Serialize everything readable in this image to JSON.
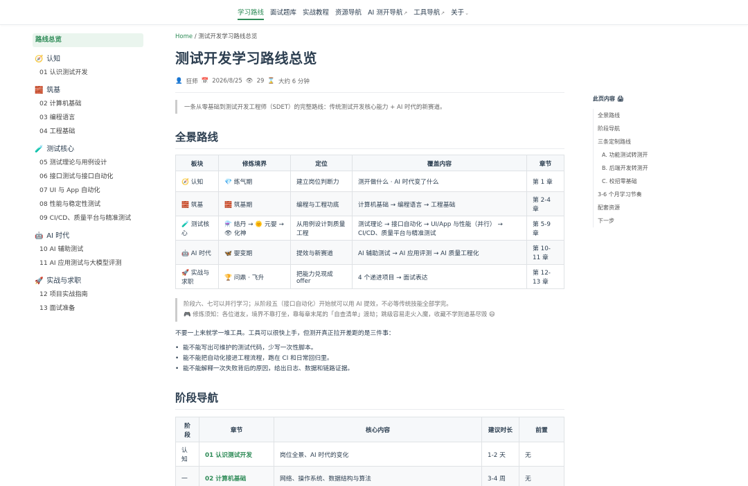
{
  "nav": {
    "items": [
      "学习路线",
      "面试题库",
      "实战教程",
      "资源导航",
      "AI 测开导航",
      "工具导航",
      "关于"
    ],
    "ext_mark": "↗",
    "dropdown_mark": "⌄"
  },
  "sidebar": {
    "overview": "路线总览",
    "groups": [
      {
        "icon": "🧭",
        "title": "认知",
        "items": [
          "01 认识测试开发"
        ]
      },
      {
        "icon": "🧱",
        "title": "筑基",
        "items": [
          "02 计算机基础",
          "03 编程语言",
          "04 工程基础"
        ]
      },
      {
        "icon": "🧪",
        "title": "测试核心",
        "items": [
          "05 测试理论与用例设计",
          "06 接口测试与接口自动化",
          "07 UI 与 App 自动化",
          "08 性能与稳定性测试",
          "09 CI/CD、质量平台与精准测试"
        ]
      },
      {
        "icon": "🤖",
        "title": "AI 时代",
        "items": [
          "10 AI 辅助测试",
          "11 AI 应用测试与大模型评测"
        ]
      },
      {
        "icon": "🚀",
        "title": "实战与求职",
        "items": [
          "12 项目实战指南",
          "13 面试准备"
        ]
      }
    ]
  },
  "main": {
    "breadcrumb": {
      "home": "Home",
      "sep": "/",
      "current": "测试开发学习路线总览"
    },
    "title": "测试开发学习路线总览",
    "meta": {
      "author_icon": "👤",
      "author": "狂师",
      "date_icon": "📅",
      "date": "2026/8/25",
      "views_icon": "👁",
      "views": "29",
      "time_icon": "⌛",
      "reading_time": "大约 6 分钟"
    },
    "intro": "一条从零基础到测试开发工程师（SDET）的完整路线：传统测试开发核心能力 + AI 时代的新赛道。",
    "section1": "全景路线",
    "table1": {
      "headers": [
        "板块",
        "修炼境界",
        "定位",
        "覆盖内容",
        "章节"
      ],
      "rows": [
        [
          "🧭 认知",
          "💎 练气期",
          "建立岗位判断力",
          "测开做什么 · AI 时代变了什么",
          "第 1 章"
        ],
        [
          "🧱 筑基",
          "🧱 筑基期",
          "编程与工程功底",
          "计算机基础 → 编程语言 → 工程基础",
          "第 2-4 章"
        ],
        [
          "🧪 测试核心",
          "⚗️ 结丹 → 🌞 元婴 → 👁 化神",
          "从用例设计到质量工程",
          "测试理论 → 接口自动化 → UI/App 与性能（并行） → CI/CD、质量平台与精准测试",
          "第 5-9 章"
        ],
        [
          "🤖 AI 时代",
          "🦋 婴变期",
          "提效与新赛道",
          "AI 辅助测试 → AI 应用评测 → AI 质量工程化",
          "第 10-11 章"
        ],
        [
          "🚀 实战与求职",
          "🏆 问鼎 · 飞升",
          "把能力兑现成 offer",
          "4 个递进项目 → 面试表达",
          "第 12-13 章"
        ]
      ]
    },
    "note_line1": "阶段六、七可以并行学习；从阶段五（接口自动化）开始就可以用 AI 提效，不必等传统技能全部学完。",
    "note_line2": "🎮 修炼须知：各位道友，境界不靠打坐，靠每章末尾的「自查清单」渡劫；跳级容易走火入魔，收藏不学则道基尽毁 😄",
    "para": "不要一上来就学一堆工具。工具可以很快上手，但测开真正拉开差距的是三件事：",
    "bullets": [
      "能不能写出可维护的测试代码，少写一次性脚本。",
      "能不能把自动化接进工程流程，跑在 CI 和日常回归里。",
      "能不能解释一次失败背后的原因，给出日志、数据和链路证据。"
    ],
    "section2": "阶段导航",
    "table2": {
      "headers": [
        "阶段",
        "章节",
        "核心内容",
        "建议时长",
        "前置"
      ],
      "rows": [
        [
          "认知",
          "01 认识测试开发",
          "岗位全景、AI 时代的变化",
          "1-2 天",
          "无"
        ],
        [
          "一",
          "02 计算机基础",
          "网络、操作系统、数据结构与算法",
          "3-4 周",
          "无"
        ]
      ]
    }
  },
  "toc": {
    "title": "此页内容",
    "print_icon": "🖨",
    "items": [
      {
        "label": "全景路线",
        "sub": false
      },
      {
        "label": "阶段导航",
        "sub": false
      },
      {
        "label": "三条定制路线",
        "sub": false
      },
      {
        "label": "A. 功能测试转测开",
        "sub": true
      },
      {
        "label": "B. 后端开发转测开",
        "sub": true
      },
      {
        "label": "C. 校招零基础",
        "sub": true
      },
      {
        "label": "3-6 个月学习节奏",
        "sub": false
      },
      {
        "label": "配套资源",
        "sub": false
      },
      {
        "label": "下一步",
        "sub": false
      }
    ]
  }
}
